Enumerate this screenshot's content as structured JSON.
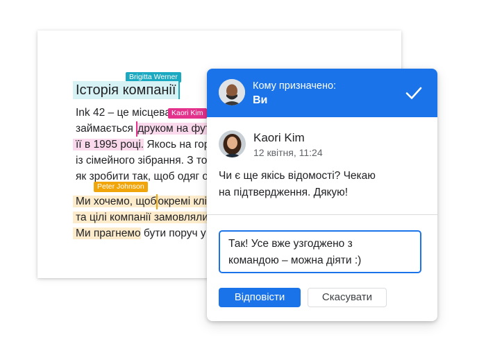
{
  "document": {
    "title": "Історія компанії",
    "lines": [
      {
        "parts": [
          "Ink 42 – це місцева",
          " "
        ]
      },
      {
        "plain": "займається ",
        "highlight": "друком на футбо"
      },
      {
        "highlight": "її в 1995 році.",
        "plain": " Якось на гориці"
      },
      {
        "plain": "із сімейного зібрання. З то"
      },
      {
        "plain": "як зробити так, щоб одяг об'є"
      },
      {
        "highlight_a": "Ми хочемо, щоб",
        "highlight_b": "окремі клієнт"
      },
      {
        "highlight": "та цілі компанії замовляли в"
      },
      {
        "highlight": "Ми прагнемо",
        "plain": " бути поруч у сл"
      }
    ],
    "collaborators": {
      "brigitta": {
        "name": "Brigitta Werner",
        "color": "#1aa9c1"
      },
      "kaori": {
        "name": "Kaori Kim",
        "color": "#e3318c"
      },
      "peter": {
        "name": "Peter Johnson",
        "color": "#f0a50b"
      }
    }
  },
  "panel": {
    "header": {
      "assigned_label": "Кому призначено:",
      "assignee": "Ви",
      "check_icon": "check-icon",
      "bg_color": "#1a73e8"
    },
    "comment": {
      "author": "Kaori Kim",
      "timestamp": "12 квітня, 11:24",
      "text_line1": "Чи є ще якісь відомості? Чекаю",
      "text_line2": "на підтвердження. Дякую!"
    },
    "reply": {
      "line1": "Так! Усе вже узгоджено з",
      "line2": "командою – можна діяти :)"
    },
    "buttons": {
      "reply": "Відповісти",
      "cancel": "Скасувати"
    }
  }
}
